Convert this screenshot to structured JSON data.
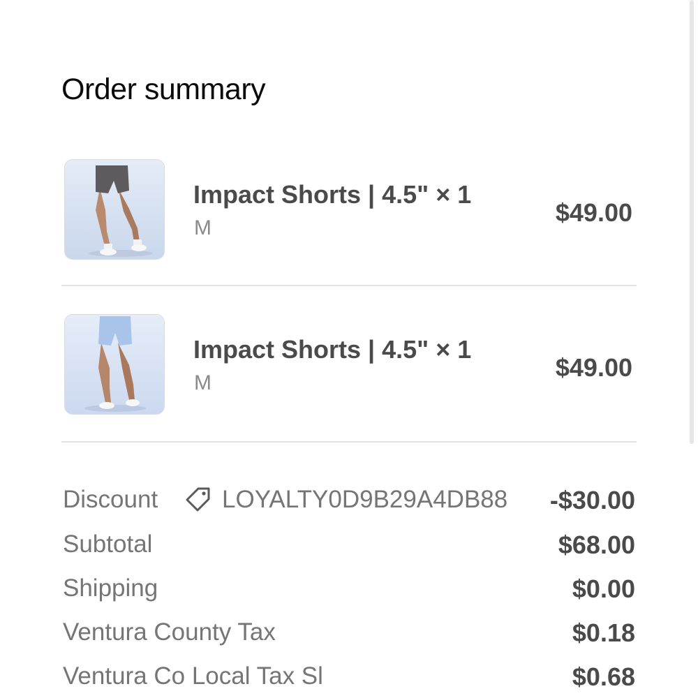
{
  "order_summary": {
    "title": "Order summary",
    "items": [
      {
        "name": "Impact Shorts | 4.5\" × 1",
        "variant": "M",
        "price": "$49.00",
        "product_color": "#5f5a5d"
      },
      {
        "name": "Impact Shorts | 4.5\" × 1",
        "variant": "M",
        "price": "$49.00",
        "product_color": "#a9c4ea"
      }
    ],
    "discount": {
      "label": "Discount",
      "code": "LOYALTY0D9B29A4DB88",
      "value": "-$30.00",
      "icon": "tag-icon"
    },
    "subtotal": {
      "label": "Subtotal",
      "value": "$68.00"
    },
    "shipping": {
      "label": "Shipping",
      "value": "$0.00"
    },
    "county_tax": {
      "label": "Ventura County Tax",
      "value": "$0.18"
    },
    "local_tax": {
      "label": "Ventura Co Local Tax Sl",
      "value": "$0.68"
    }
  }
}
